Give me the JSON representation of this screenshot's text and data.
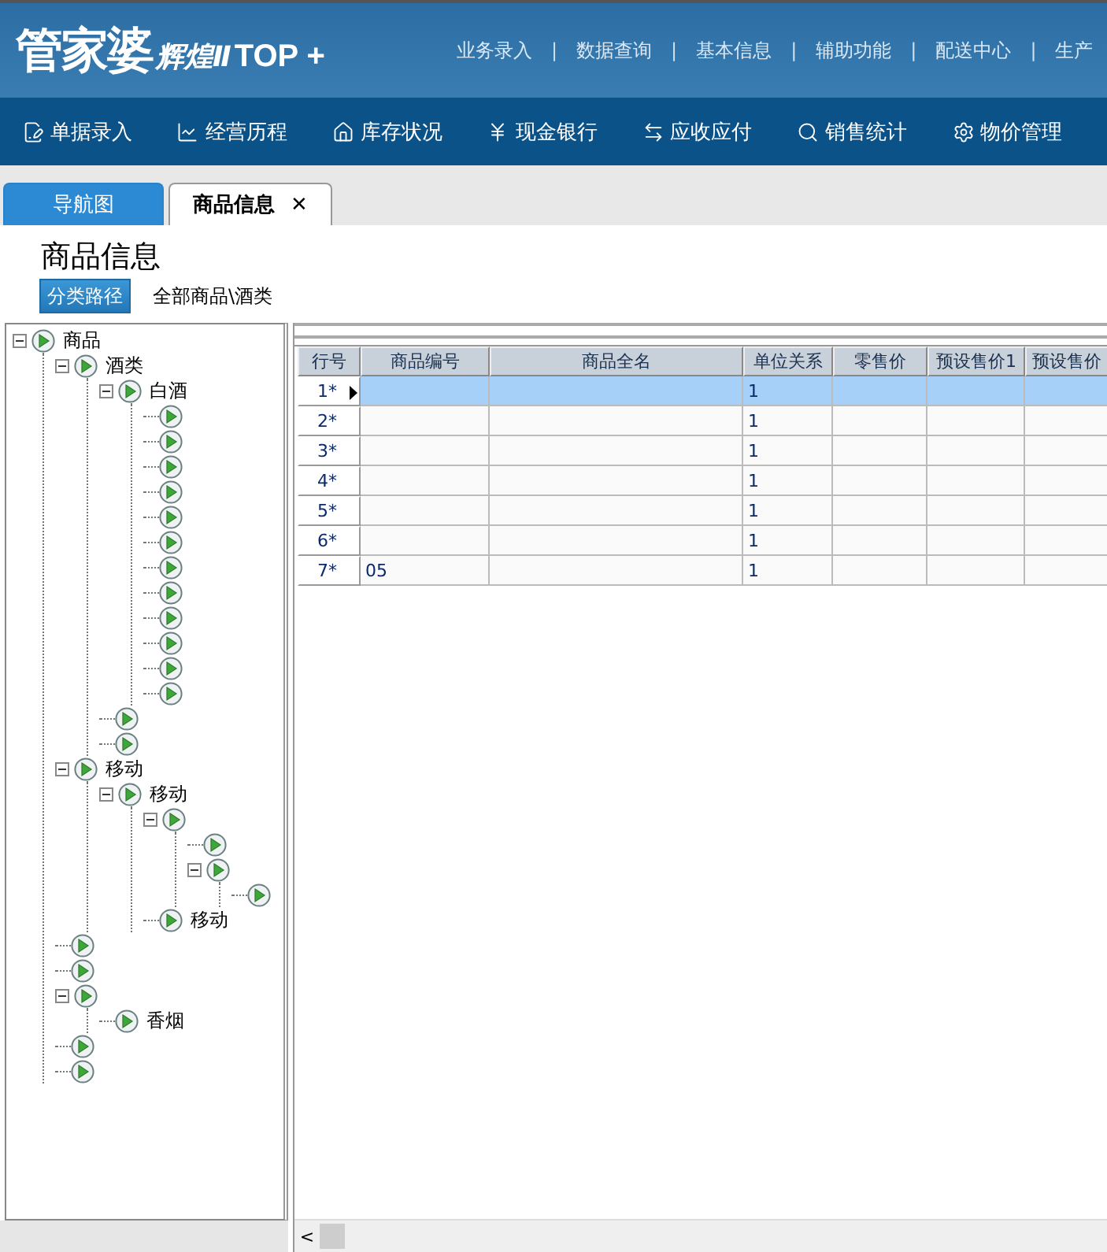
{
  "logo": {
    "brand": "管家婆",
    "edition": "辉煌Ⅱ",
    "suffix": "TOP +"
  },
  "top_menu": [
    "业务录入",
    "数据查询",
    "基本信息",
    "辅助功能",
    "配送中心",
    "生产"
  ],
  "menu_separator": "|",
  "toolbar": [
    {
      "label": "单据录入",
      "kind": "doc"
    },
    {
      "label": "经营历程",
      "kind": "chart"
    },
    {
      "label": "库存状况",
      "kind": "home"
    },
    {
      "label": "现金银行",
      "kind": "yen"
    },
    {
      "label": "应收应付",
      "kind": "swap"
    },
    {
      "label": "销售统计",
      "kind": "search"
    },
    {
      "label": "物价管理",
      "kind": "gear"
    }
  ],
  "tabs": [
    {
      "label": "导航图",
      "selected": false,
      "closable": false
    },
    {
      "label": "商品信息",
      "selected": true,
      "closable": true
    }
  ],
  "close_glyph": "✕",
  "page_title": "商品信息",
  "path_button": "分类路径",
  "path": "全部商品\\酒类",
  "tree": [
    {
      "kind": "folder",
      "label": "商品",
      "expanded": true,
      "children": [
        {
          "kind": "folder",
          "label": "酒类",
          "expanded": true,
          "children": [
            {
              "kind": "folder",
              "label": "白酒",
              "expanded": true,
              "children": [
                {
                  "kind": "leaf"
                },
                {
                  "kind": "leaf"
                },
                {
                  "kind": "leaf"
                },
                {
                  "kind": "leaf"
                },
                {
                  "kind": "leaf"
                },
                {
                  "kind": "leaf"
                },
                {
                  "kind": "leaf"
                },
                {
                  "kind": "leaf"
                },
                {
                  "kind": "leaf"
                },
                {
                  "kind": "leaf"
                },
                {
                  "kind": "leaf"
                },
                {
                  "kind": "leaf"
                }
              ]
            },
            {
              "kind": "leaf"
            },
            {
              "kind": "leaf"
            }
          ]
        },
        {
          "kind": "folder",
          "label": "移动",
          "expanded": true,
          "children": [
            {
              "kind": "folder",
              "label": "移动",
              "expanded": true,
              "children": [
                {
                  "kind": "folder",
                  "expanded": true,
                  "children": [
                    {
                      "kind": "leaf"
                    },
                    {
                      "kind": "folder",
                      "expanded": true,
                      "children": [
                        {
                          "kind": "leaf"
                        }
                      ]
                    }
                  ]
                },
                {
                  "kind": "leaf",
                  "label": "移动"
                }
              ]
            }
          ]
        },
        {
          "kind": "leaf"
        },
        {
          "kind": "leaf"
        },
        {
          "kind": "folder",
          "expanded": true,
          "children": [
            {
              "kind": "leaf",
              "label": "香烟"
            }
          ]
        },
        {
          "kind": "leaf"
        },
        {
          "kind": "leaf"
        }
      ]
    }
  ],
  "table": {
    "columns": [
      "行号",
      "商品编号",
      "商品全名",
      "单位关系",
      "零售价",
      "预设售价1",
      "预设售价"
    ],
    "rows": [
      {
        "row_no": "1*",
        "unit": "1",
        "selected": true
      },
      {
        "row_no": "2*",
        "unit": "1",
        "selected": false
      },
      {
        "row_no": "3*",
        "unit": "1",
        "selected": false
      },
      {
        "row_no": "4*",
        "unit": "1",
        "selected": false
      },
      {
        "row_no": "5*",
        "unit": "1",
        "selected": false
      },
      {
        "row_no": "6*",
        "unit": "1",
        "selected": false
      },
      {
        "row_no": "7*",
        "code": "05",
        "unit": "1",
        "selected": false
      }
    ]
  },
  "scroll_left_glyph": "<"
}
